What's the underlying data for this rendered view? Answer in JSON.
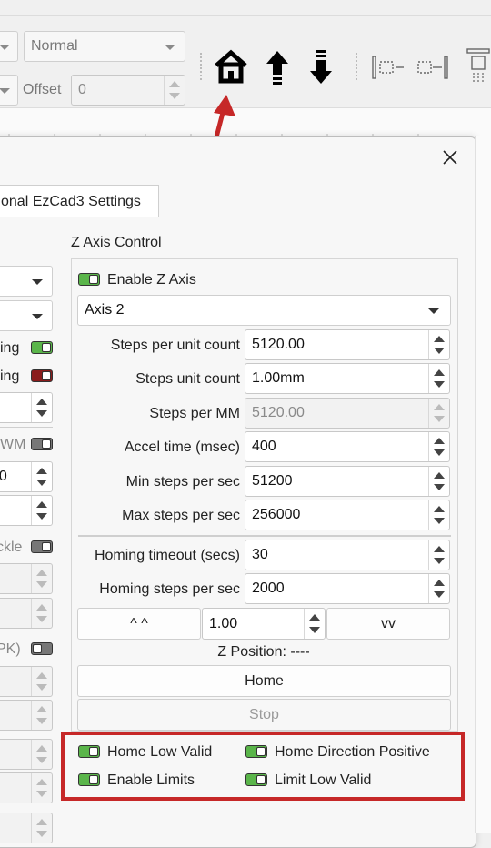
{
  "toolbar": {
    "style_combo": "Normal",
    "offset_label": "Offset",
    "offset_value": "0"
  },
  "dialog": {
    "tab_label": "onal EzCad3 Settings",
    "left_partial_labels": [
      "ing",
      "ing",
      "WM",
      "00",
      "ckle",
      "PK)"
    ],
    "z_axis": {
      "section_title": "Z Axis Control",
      "enable_label": "Enable Z Axis",
      "axis_select": "Axis 2",
      "fields": [
        {
          "label": "Steps per unit count",
          "value": "5120.00"
        },
        {
          "label": "Steps unit count",
          "value": "1.00mm"
        },
        {
          "label": "Steps per MM",
          "value": "5120.00"
        },
        {
          "label": "Accel time (msec)",
          "value": "400"
        },
        {
          "label": "Min steps per sec",
          "value": "51200"
        },
        {
          "label": "Max steps per sec",
          "value": "256000"
        },
        {
          "label": "Homing timeout (secs)",
          "value": "30"
        },
        {
          "label": "Homing steps per sec",
          "value": "2000"
        }
      ],
      "jog_up_label": "^ ^",
      "jog_value": "1.00",
      "jog_down_label": "vv",
      "position_label": "Z Position: ----",
      "home_button": "Home",
      "stop_button": "Stop",
      "options": [
        {
          "label": "Home Low Valid"
        },
        {
          "label": "Home Direction Positive"
        },
        {
          "label": "Enable Limits"
        },
        {
          "label": "Limit Low Valid"
        }
      ]
    }
  },
  "colors": {
    "toggle_on": "#5ab54a",
    "highlight_box": "#c62828",
    "arrow": "#c62828"
  }
}
